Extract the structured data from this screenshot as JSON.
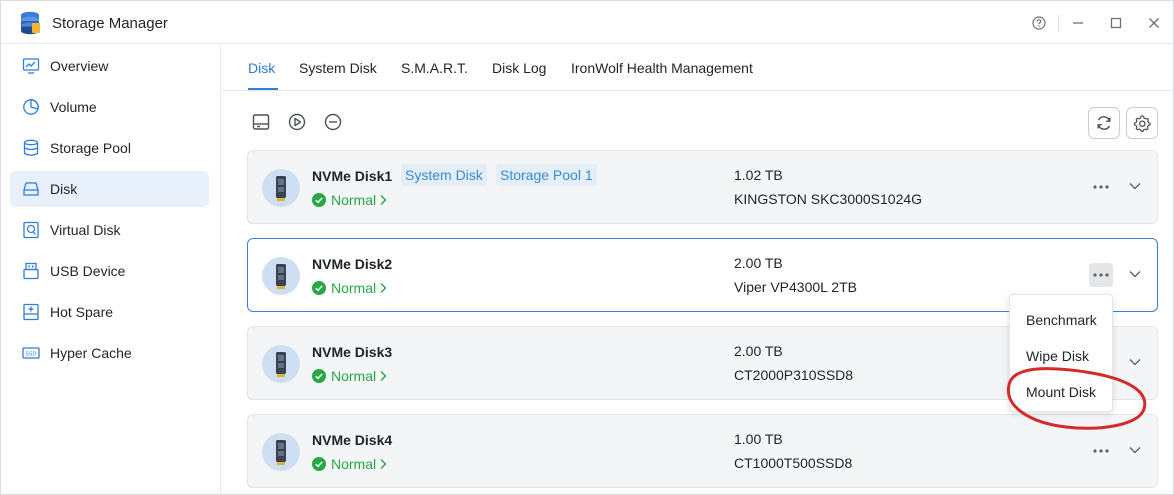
{
  "app": {
    "title": "Storage Manager"
  },
  "window_controls": {
    "help": "help-icon",
    "minimize": "minimize-icon",
    "maximize": "maximize-icon",
    "close": "close-icon"
  },
  "sidebar": {
    "items": [
      {
        "label": "Overview",
        "icon": "overview-icon",
        "active": false
      },
      {
        "label": "Volume",
        "icon": "volume-icon",
        "active": false
      },
      {
        "label": "Storage Pool",
        "icon": "storage-pool-icon",
        "active": false
      },
      {
        "label": "Disk",
        "icon": "disk-icon",
        "active": true
      },
      {
        "label": "Virtual Disk",
        "icon": "virtual-disk-icon",
        "active": false
      },
      {
        "label": "USB Device",
        "icon": "usb-icon",
        "active": false
      },
      {
        "label": "Hot Spare",
        "icon": "hot-spare-icon",
        "active": false
      },
      {
        "label": "Hyper Cache",
        "icon": "hyper-cache-icon",
        "active": false
      }
    ]
  },
  "tabs": [
    {
      "label": "Disk",
      "active": true
    },
    {
      "label": "System Disk",
      "active": false
    },
    {
      "label": "S.M.A.R.T.",
      "active": false
    },
    {
      "label": "Disk Log",
      "active": false
    },
    {
      "label": "IronWolf Health Management",
      "active": false
    }
  ],
  "toolbar": {
    "icons": [
      "drive-icon",
      "play-circle-icon",
      "minus-circle-icon",
      "refresh-icon",
      "settings-icon"
    ]
  },
  "disks": [
    {
      "name": "NVMe Disk1",
      "tags": [
        "System Disk",
        "Storage Pool 1"
      ],
      "status": "Normal",
      "capacity": "1.02 TB",
      "model": "KINGSTON SKC3000S1024G",
      "selected": false
    },
    {
      "name": "NVMe Disk2",
      "tags": [],
      "status": "Normal",
      "capacity": "2.00 TB",
      "model": "Viper VP4300L 2TB",
      "selected": true
    },
    {
      "name": "NVMe Disk3",
      "tags": [],
      "status": "Normal",
      "capacity": "2.00 TB",
      "model": "CT2000P310SSD8",
      "selected": false
    },
    {
      "name": "NVMe Disk4",
      "tags": [],
      "status": "Normal",
      "capacity": "1.00 TB",
      "model": "CT1000T500SSD8",
      "selected": false
    }
  ],
  "context_menu": {
    "items": [
      "Benchmark",
      "Wipe Disk",
      "Mount Disk"
    ],
    "highlighted": "Mount Disk"
  },
  "colors": {
    "accent": "#2f7ed8",
    "status_ok": "#27a844",
    "annotation": "#d42a2a"
  }
}
